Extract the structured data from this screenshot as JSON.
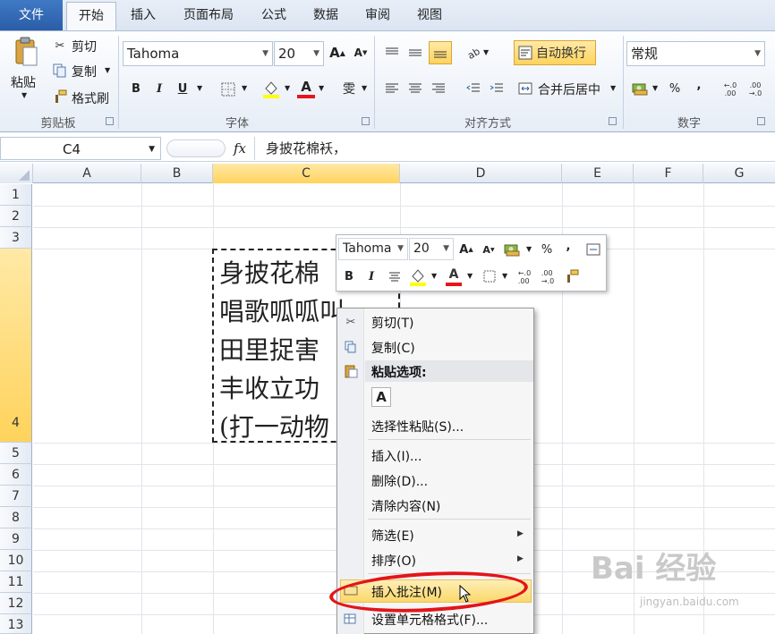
{
  "tabs": [
    "文件",
    "开始",
    "插入",
    "页面布局",
    "公式",
    "数据",
    "审阅",
    "视图"
  ],
  "ribbon": {
    "clipboard": {
      "paste": "粘贴",
      "cut": "剪切",
      "copy": "复制",
      "format_painter": "格式刷",
      "label": "剪贴板"
    },
    "font": {
      "name": "Tahoma",
      "size": "20",
      "bold": "B",
      "italic": "I",
      "underline": "U",
      "font_color_glyph": "A",
      "grow": "A",
      "shrink": "A",
      "phonetic": "雯",
      "label": "字体"
    },
    "alignment": {
      "wrap": "自动换行",
      "merge": "合并后居中",
      "label": "对齐方式"
    },
    "number": {
      "format": "常规",
      "percent": "%",
      "comma": ",",
      "inc": "+.0\n.00",
      "dec": ".00\n→.0",
      "label": "数字"
    }
  },
  "formula_bar": {
    "name_box": "C4",
    "fx": "fx",
    "content": "身披花棉袄，"
  },
  "columns": [
    "A",
    "B",
    "C",
    "D",
    "E",
    "F",
    "G"
  ],
  "rows": [
    "1",
    "2",
    "3",
    "4",
    "5",
    "6",
    "7",
    "8",
    "9",
    "10",
    "11",
    "12",
    "13"
  ],
  "cell_text": "身披花棉\n唱歌呱呱叫\n田里捉害\n丰收立功\n(打一动物",
  "mini_toolbar": {
    "font": "Tahoma",
    "size": "20",
    "bold": "B",
    "italic": "I",
    "percent": "%",
    "comma": ","
  },
  "context_menu": [
    {
      "label": "剪切(T)",
      "icon": "scissors-icon"
    },
    {
      "label": "复制(C)",
      "icon": "copy-icon"
    },
    {
      "label": "粘贴选项:",
      "icon": "paste-icon"
    },
    {
      "label": "A",
      "icon": "paste-text-icon"
    },
    {
      "label": "选择性粘贴(S)...",
      "icon": ""
    },
    {
      "label": "插入(I)...",
      "icon": ""
    },
    {
      "label": "删除(D)...",
      "icon": ""
    },
    {
      "label": "清除内容(N)",
      "icon": ""
    },
    {
      "label": "筛选(E)",
      "icon": ""
    },
    {
      "label": "排序(O)",
      "icon": ""
    },
    {
      "label": "插入批注(M)",
      "icon": "comment-icon"
    },
    {
      "label": "设置单元格格式(F)...",
      "icon": "format-cells-icon"
    }
  ],
  "watermark": {
    "brand": "Bai 经验",
    "url": "jingyan.baidu.com"
  }
}
